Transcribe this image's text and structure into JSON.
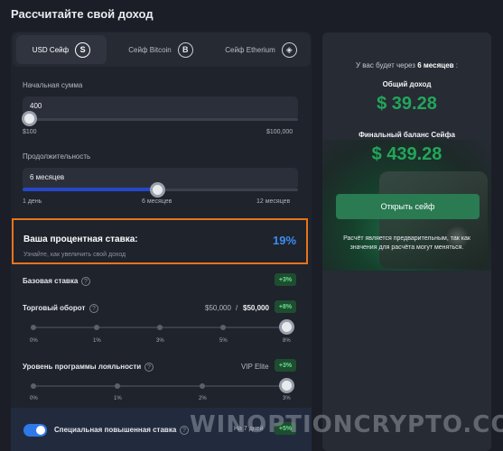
{
  "header": {
    "title": "Рассчитайте свой доход"
  },
  "tabs": [
    {
      "label": "USD Сейф",
      "icon": "S",
      "active": true
    },
    {
      "label": "Сейф Bitcoin",
      "icon": "B",
      "active": false
    },
    {
      "label": "Сейф Etherium",
      "icon": "◈",
      "active": false
    }
  ],
  "amount": {
    "label": "Начальная сумма",
    "value": "400",
    "min_label": "$100",
    "max_label": "$100,000",
    "slider_fraction": 0.003
  },
  "duration": {
    "label": "Продолжительность",
    "value": "6 месяцев",
    "ticks": [
      "1 день",
      "6 месяцев",
      "12 месяцев"
    ],
    "slider_fraction": 0.5
  },
  "rate": {
    "title": "Ваша процентная ставка:",
    "value": "19%",
    "subtitle": "Узнайте, как увеличить свой доход"
  },
  "base_rate": {
    "label": "Базовая ставка",
    "badge": "+3%"
  },
  "turnover": {
    "label": "Торговый оборот",
    "current": "$50,000",
    "separator": "/",
    "max": "$50,000",
    "badge": "+8%",
    "steps": [
      "0%",
      "1%",
      "3%",
      "5%",
      "8%"
    ],
    "selected_index": 4
  },
  "loyalty": {
    "label": "Уровень программы лояльности",
    "level": "VIP Elite",
    "badge": "+3%",
    "steps": [
      "0%",
      "1%",
      "2%",
      "3%"
    ],
    "selected_index": 3
  },
  "special": {
    "label": "Специальная повышенная ставка",
    "period": "На 7 дней",
    "badge": "+5%",
    "enabled": true
  },
  "summary": {
    "prefix": "У вас будет через",
    "period": "6 месяцев",
    "suffix": ":",
    "income_label": "Общий доход",
    "income_value": "$ 39.28",
    "final_label": "Финальный баланс Сейфа",
    "final_value": "$ 439.28",
    "button": "Открыть сейф",
    "note_line1": "Расчёт является предварительным, так как",
    "note_line2": "значения для расчёта могут меняться."
  },
  "watermark": "WINOPTIONCRYPTO.COM",
  "colors": {
    "accent_green": "#22a65a",
    "accent_blue": "#3b8df0",
    "highlight_orange": "#e8741b"
  }
}
